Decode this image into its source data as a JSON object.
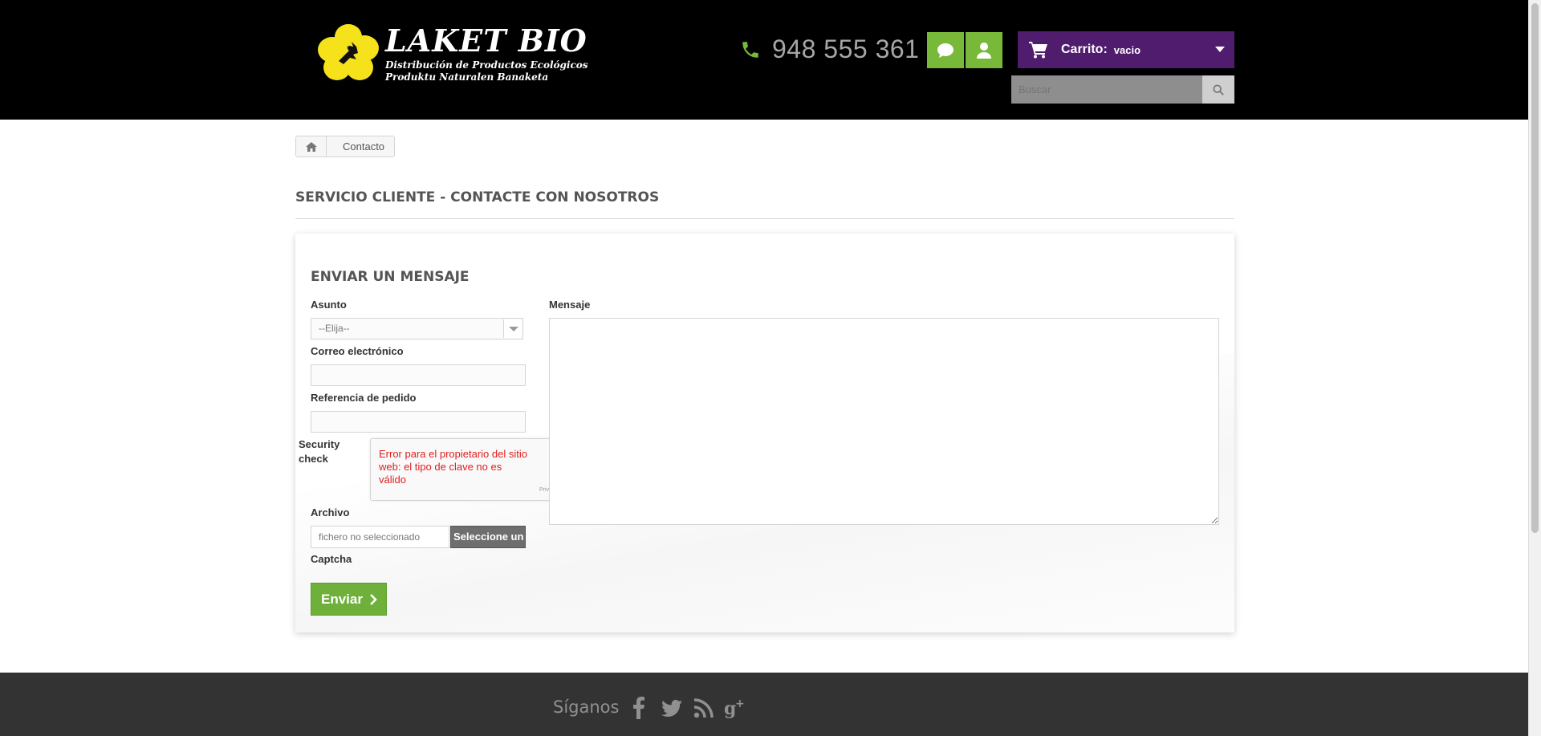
{
  "header": {
    "logo": {
      "title": "LAKET BIO",
      "subtitle_line1": "Distribución de Productos Ecológicos",
      "subtitle_line2": "Produktu Naturalen Banaketa"
    },
    "phone": "948 555 361",
    "cart": {
      "label": "Carrito:",
      "value": "vacio"
    },
    "search": {
      "placeholder": "Buscar"
    }
  },
  "breadcrumb": {
    "current": "Contacto"
  },
  "page_title": "SERVICIO CLIENTE - CONTACTE CON NOSOTROS",
  "contact_form": {
    "title": "ENVIAR UN MENSAJE",
    "subject_label": "Asunto",
    "subject_value": "--Elija--",
    "email_label": "Correo electrónico",
    "order_label": "Referencia de pedido",
    "security_label_line1": "Security",
    "security_label_line2": "check",
    "captcha_error": "Error para el propietario del sitio web: el tipo de clave no es válido",
    "captcha_privacy": "Priv",
    "file_label": "Archivo",
    "file_placeholder": "fichero no seleccionado",
    "file_button": "Seleccione un",
    "captcha_label": "Captcha",
    "submit": "Enviar",
    "message_label": "Mensaje"
  },
  "footer": {
    "follow_label": "Síganos",
    "social": [
      "facebook-icon",
      "twitter-icon",
      "rss-icon",
      "google-plus-icon"
    ]
  },
  "colors": {
    "header_bg": "#000000",
    "accent_green": "#79b93a",
    "cart_purple": "#4f1c6e",
    "footer_bg": "#333333",
    "error_red": "#e02020"
  }
}
